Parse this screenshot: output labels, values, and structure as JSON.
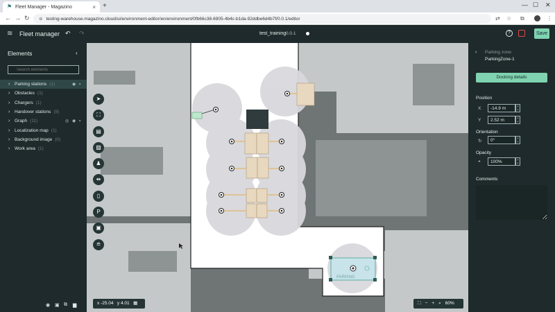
{
  "browser": {
    "tab_title": "Fleet Manager - Magazino",
    "new_tab": "+",
    "url": "testing-warehouse.magazino.cloud/ui/environment-editor/en/environment/0fb66c38-6905-4b4c-b1da-92ddbe6d4b7f/0.0.1/editor"
  },
  "app": {
    "title": "Fleet manager",
    "project_name": "test_training",
    "project_version": "0.0.1",
    "save_label": "Save"
  },
  "left_panel": {
    "title": "Elements",
    "search_placeholder": "Search elements",
    "items": [
      {
        "label": "Parking stations",
        "count": "(1)"
      },
      {
        "label": "Obstacles",
        "count": "(1)"
      },
      {
        "label": "Chargers",
        "count": "(1)"
      },
      {
        "label": "Handover stations",
        "count": "(9)"
      },
      {
        "label": "Graph",
        "count": "(11)"
      },
      {
        "label": "Localization map",
        "count": "(1)"
      },
      {
        "label": "Background image",
        "count": "(0)"
      },
      {
        "label": "Work area",
        "count": "(1)"
      }
    ]
  },
  "canvas": {
    "coord_x": "x -25.04",
    "coord_y": "y 4.01",
    "zoom": "60%",
    "parking_label": "PARKING"
  },
  "right_panel": {
    "element_type": "Parking zone",
    "element_name": "ParkingZone-1",
    "docking_button": "Docking details",
    "position_label": "Position",
    "x_axis": "X",
    "y_axis": "Y",
    "x_value": "-14.9 m",
    "y_value": "2.52 m",
    "orientation_label": "Orientation",
    "orientation_value": "0°",
    "opacity_label": "Opacity",
    "opacity_value": "100%",
    "comments_label": "Comments"
  },
  "colors": {
    "accent": "#7fd3b0",
    "panel_bg": "#1e2a2b",
    "map_unknown": "#6f7474",
    "map_free": "#ffffff",
    "shelf": "#e8d8bf"
  }
}
